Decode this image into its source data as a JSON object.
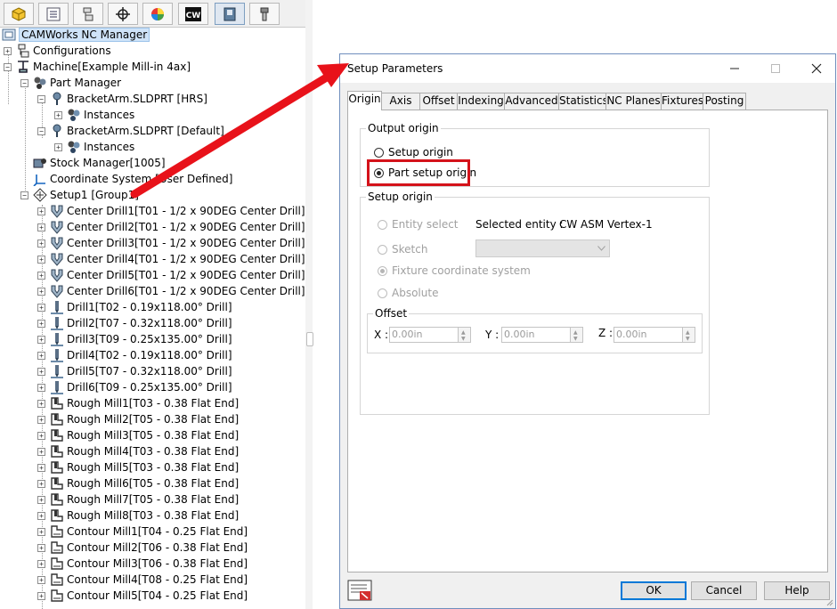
{
  "tree": {
    "root": "CAMWorks NC Manager",
    "items": [
      {
        "label": "Configurations",
        "icon": "configurations-icon"
      },
      {
        "label": "Machine[Example Mill-in 4ax]",
        "icon": "machine-icon"
      },
      {
        "label": "Part Manager",
        "icon": "part-manager-icon"
      },
      {
        "label": "BracketArm.SLDPRT [HRS]",
        "icon": "part-pin-icon"
      },
      {
        "label": "Instances",
        "icon": "instances-icon"
      },
      {
        "label": "BracketArm.SLDPRT [Default]",
        "icon": "part-pin-icon"
      },
      {
        "label": "Instances",
        "icon": "instances-icon"
      },
      {
        "label": "Stock Manager[1005]",
        "icon": "stock-manager-icon"
      },
      {
        "label": "Coordinate System [User Defined]",
        "icon": "coordinate-system-icon"
      },
      {
        "label": "Setup1 [Group1]",
        "icon": "setup-icon"
      },
      {
        "label": "Center Drill1[T01 - 1/2 x 90DEG Center Drill]",
        "icon": "center-drill-icon"
      },
      {
        "label": "Center Drill2[T01 - 1/2 x 90DEG Center Drill]",
        "icon": "center-drill-icon"
      },
      {
        "label": "Center Drill3[T01 - 1/2 x 90DEG Center Drill]",
        "icon": "center-drill-icon"
      },
      {
        "label": "Center Drill4[T01 - 1/2 x 90DEG Center Drill]",
        "icon": "center-drill-icon"
      },
      {
        "label": "Center Drill5[T01 - 1/2 x 90DEG Center Drill]",
        "icon": "center-drill-icon"
      },
      {
        "label": "Center Drill6[T01 - 1/2 x 90DEG Center Drill]",
        "icon": "center-drill-icon"
      },
      {
        "label": "Drill1[T02 - 0.19x118.00° Drill]",
        "icon": "drill-icon"
      },
      {
        "label": "Drill2[T07 - 0.32x118.00° Drill]",
        "icon": "drill-icon"
      },
      {
        "label": "Drill3[T09 - 0.25x135.00° Drill]",
        "icon": "drill-icon"
      },
      {
        "label": "Drill4[T02 - 0.19x118.00° Drill]",
        "icon": "drill-icon"
      },
      {
        "label": "Drill5[T07 - 0.32x118.00° Drill]",
        "icon": "drill-icon"
      },
      {
        "label": "Drill6[T09 - 0.25x135.00° Drill]",
        "icon": "drill-icon"
      },
      {
        "label": "Rough Mill1[T03 - 0.38 Flat End]",
        "icon": "rough-mill-icon"
      },
      {
        "label": "Rough Mill2[T05 - 0.38 Flat End]",
        "icon": "rough-mill-icon"
      },
      {
        "label": "Rough Mill3[T05 - 0.38 Flat End]",
        "icon": "rough-mill-icon"
      },
      {
        "label": "Rough Mill4[T03 - 0.38 Flat End]",
        "icon": "rough-mill-icon"
      },
      {
        "label": "Rough Mill5[T03 - 0.38 Flat End]",
        "icon": "rough-mill-icon"
      },
      {
        "label": "Rough Mill6[T05 - 0.38 Flat End]",
        "icon": "rough-mill-icon"
      },
      {
        "label": "Rough Mill7[T05 - 0.38 Flat End]",
        "icon": "rough-mill-icon"
      },
      {
        "label": "Rough Mill8[T03 - 0.38 Flat End]",
        "icon": "rough-mill-icon"
      },
      {
        "label": "Contour Mill1[T04 - 0.25 Flat End]",
        "icon": "contour-mill-icon"
      },
      {
        "label": "Contour Mill2[T06 - 0.38 Flat End]",
        "icon": "contour-mill-icon"
      },
      {
        "label": "Contour Mill3[T06 - 0.38 Flat End]",
        "icon": "contour-mill-icon"
      },
      {
        "label": "Contour Mill4[T08 - 0.25 Flat End]",
        "icon": "contour-mill-icon"
      },
      {
        "label": "Contour Mill5[T04 - 0.25 Flat End]",
        "icon": "contour-mill-icon"
      }
    ]
  },
  "dialog": {
    "title": "Setup Parameters",
    "tabs": [
      "Origin",
      "Axis",
      "Offset",
      "Indexing",
      "Advanced",
      "Statistics",
      "NC Planes",
      "Fixtures",
      "Posting"
    ],
    "active_tab": "Origin",
    "output_origin": {
      "title": "Output origin",
      "options": [
        "Setup origin",
        "Part setup origin"
      ],
      "selected": "Part setup origin"
    },
    "setup_origin": {
      "title": "Setup origin",
      "entity_select": "Entity select",
      "selected_entity_label": "Selected entity :",
      "selected_entity_value": "CW ASM Vertex-1",
      "sketch": "Sketch",
      "fixture": "Fixture coordinate system",
      "absolute": "Absolute"
    },
    "offset": {
      "title": "Offset",
      "x_label": "X :",
      "x_value": "0.00in",
      "y_label": "Y :",
      "y_value": "0.00in",
      "z_label": "Z :",
      "z_value": "0.00in"
    },
    "buttons": {
      "ok": "OK",
      "cancel": "Cancel",
      "help": "Help"
    }
  },
  "colors": {
    "arrow": "#e8121a",
    "highlight_box": "#d4121a",
    "selection": "#cfe3f8"
  }
}
